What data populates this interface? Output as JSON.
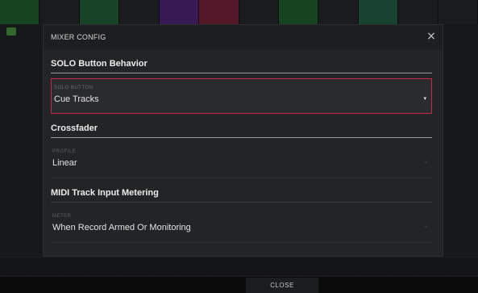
{
  "dialog": {
    "title": "MIXER CONFIG",
    "close_symbol": "×"
  },
  "sections": {
    "solo": {
      "heading": "SOLO Button Behavior",
      "field_label": "SOLO BUTTON",
      "field_value": "Cue Tracks"
    },
    "crossfader": {
      "heading": "Crossfader",
      "field_label": "PROFILE",
      "field_value": "Linear"
    },
    "midi_metering": {
      "heading": "MIDI Track Input Metering",
      "field_label": "METER",
      "field_value": "When Record Armed Or Monitoring"
    }
  },
  "footer": {
    "close_label": "CLOSE"
  },
  "icons": {
    "dropdown": "▾",
    "close": "×"
  },
  "colors": {
    "active_border": "#c6284a",
    "dialog_bg": "#232426",
    "header_bg": "#1d1e20",
    "track_colors": [
      "#1f6b2a",
      "#2a2a2a",
      "#1e6b3a",
      "#2a2a2a",
      "#5a1f8a",
      "#8a1f3a",
      "#2a2a2a",
      "#1f6b2a",
      "#2a2a2a",
      "#1e6b4a",
      "#2a2a2a",
      "#2a2a2a"
    ]
  }
}
